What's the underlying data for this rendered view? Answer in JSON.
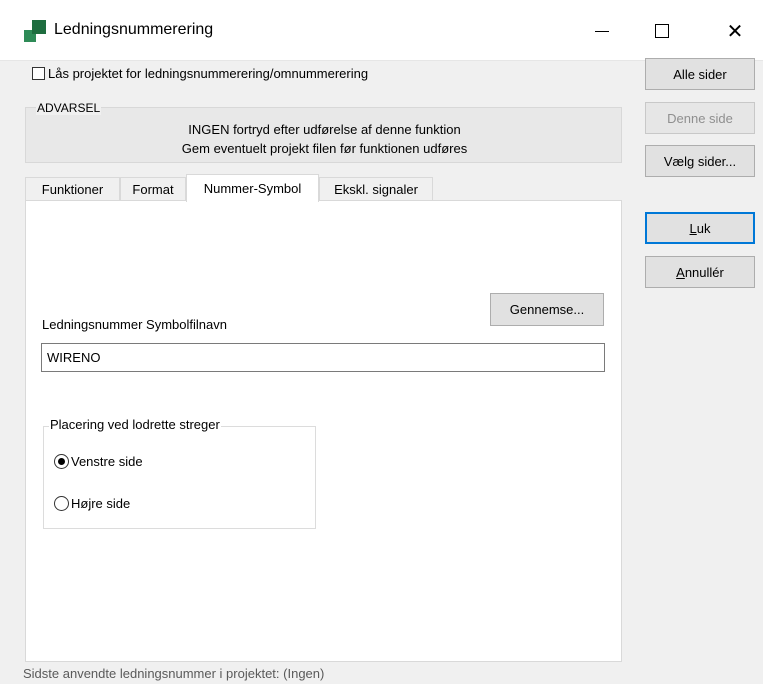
{
  "window": {
    "title": "Ledningsnummerering",
    "icon": "app-icon",
    "controls": {
      "minimize": "minimize-icon",
      "maximize": "maximize-icon",
      "close_glyph": "✕"
    }
  },
  "lock_checkbox": {
    "label": "Lås projektet for ledningsnummerering/omnummerering",
    "checked": false
  },
  "warning": {
    "legend": "ADVARSEL",
    "line1": "INGEN fortryd efter udførelse af denne funktion",
    "line2": "Gem eventuelt projekt filen før funktionen udføres"
  },
  "tabs": [
    {
      "label": "Funktioner",
      "active": false
    },
    {
      "label": "Format",
      "active": false
    },
    {
      "label": "Nummer-Symbol",
      "active": true
    },
    {
      "label": "Ekskl. signaler",
      "active": false
    }
  ],
  "panel": {
    "browse_button": "Gennemse...",
    "symbol_label": "Ledningsnummer Symbolfilnavn",
    "symbol_value": "WIRENO",
    "group_legend": "Placering ved lodrette streger",
    "radio_left": "Venstre side",
    "radio_right": "Højre side",
    "selected": "Venstre side"
  },
  "side_buttons": {
    "alle": "Alle sider",
    "denne": "Denne side",
    "vaelg": "Vælg sider...",
    "luk_u": "L",
    "luk_rest": "uk",
    "annul_u": "A",
    "annul_rest": "nnullér"
  },
  "status": "Sidste anvendte ledningsnummer i projektet: (Ingen)",
  "colors": {
    "accent": "#0078d7",
    "icon_green": "#2e8b57"
  }
}
